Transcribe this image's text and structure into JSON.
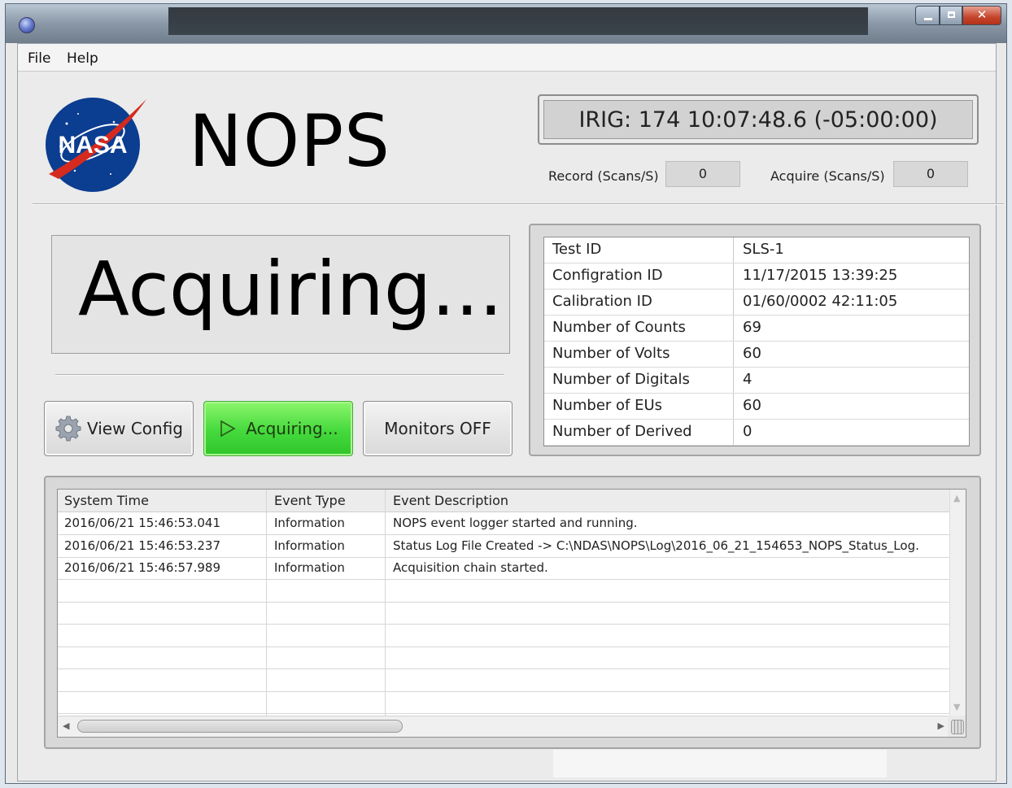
{
  "menu": {
    "file": "File",
    "help": "Help"
  },
  "header": {
    "app_name": "NOPS",
    "logo_text": "NASA"
  },
  "irig": {
    "text": "IRIG: 174 10:07:48.6 (-05:00:00)"
  },
  "rates": {
    "record_label": "Record (Scans/S)",
    "record_value": "0",
    "acquire_label": "Acquire (Scans/S)",
    "acquire_value": "0"
  },
  "status": {
    "text": "Acquiring..."
  },
  "buttons": {
    "view_config": "View Config",
    "acquiring": "Acquiring...",
    "monitors": "Monitors OFF"
  },
  "info": [
    {
      "key": "Test ID",
      "value": "SLS-1"
    },
    {
      "key": "Configration ID",
      "value": "11/17/2015 13:39:25"
    },
    {
      "key": "Calibration ID",
      "value": "01/60/0002 42:11:05"
    },
    {
      "key": "Number of Counts",
      "value": "69"
    },
    {
      "key": "Number of Volts",
      "value": "60"
    },
    {
      "key": "Number of Digitals",
      "value": "4"
    },
    {
      "key": "Number of EUs",
      "value": "60"
    },
    {
      "key": "Number of Derived",
      "value": "0"
    }
  ],
  "log": {
    "headers": [
      "System Time",
      "Event Type",
      "Event Description"
    ],
    "rows": [
      [
        "2016/06/21 15:46:53.041",
        "Information",
        "NOPS event logger started and running."
      ],
      [
        "2016/06/21 15:46:53.237",
        "Information",
        "Status Log File Created -> C:\\NDAS\\NOPS\\Log\\2016_06_21_154653_NOPS_Status_Log."
      ],
      [
        "2016/06/21 15:46:57.989",
        "Information",
        "Acquisition chain started."
      ]
    ]
  },
  "colors": {
    "acquiring_button": "#45d93c",
    "nasa_blue": "#0b3d91",
    "nasa_red": "#d52b1e"
  }
}
